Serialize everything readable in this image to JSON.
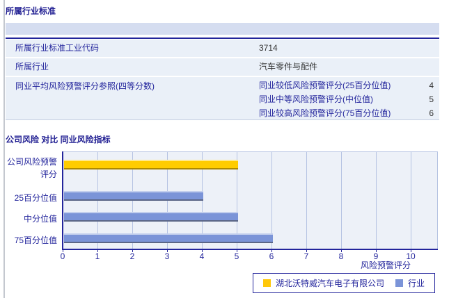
{
  "sections": {
    "industry_standard_title": "所属行业标准",
    "risk_comparison_title": "公司风险 对比 同业风险指标"
  },
  "industry_table": {
    "rows": [
      {
        "label": "所属行业标准工业代码",
        "value": "3714"
      },
      {
        "label": "所属行业",
        "value": "汽车零件与配件"
      },
      {
        "label": "同业平均风险预警评分参照(四等分数)",
        "subrows": [
          {
            "label": "同业较低风险预警评分(25百分位值)",
            "value": "4"
          },
          {
            "label": "同业中等风险预警评分(中位值)",
            "value": "5"
          },
          {
            "label": "同业较高风险预警评分(75百分位值)",
            "value": "6"
          }
        ]
      }
    ]
  },
  "chart_data": {
    "type": "bar",
    "orientation": "horizontal",
    "categories": [
      "公司风险预警评分",
      "25百分位值",
      "中分位值",
      "75百分位值"
    ],
    "values": [
      5,
      4,
      5,
      6
    ],
    "bar_series": [
      "company",
      "industry",
      "industry",
      "industry"
    ],
    "series_colors": {
      "company": "#FFCC00",
      "industry": "#7B94D8"
    },
    "xlabel": "风险预警评分",
    "xlim": [
      0,
      10
    ],
    "xticks": [
      0,
      1,
      2,
      3,
      4,
      5,
      6,
      7,
      8,
      9,
      10
    ],
    "grid": "vertical",
    "legend_position": "bottom-right",
    "legend": [
      {
        "series": "company",
        "label": "湖北沃特威汽车电子有限公司",
        "color": "#FFC80A"
      },
      {
        "series": "industry",
        "label": "行业",
        "color": "#7B94D8"
      }
    ],
    "colors": {
      "plot_bg": "#EDF1F8",
      "gridline": "#B5C3E2",
      "axis": "#23259C",
      "accent_text": "#23259C"
    }
  }
}
